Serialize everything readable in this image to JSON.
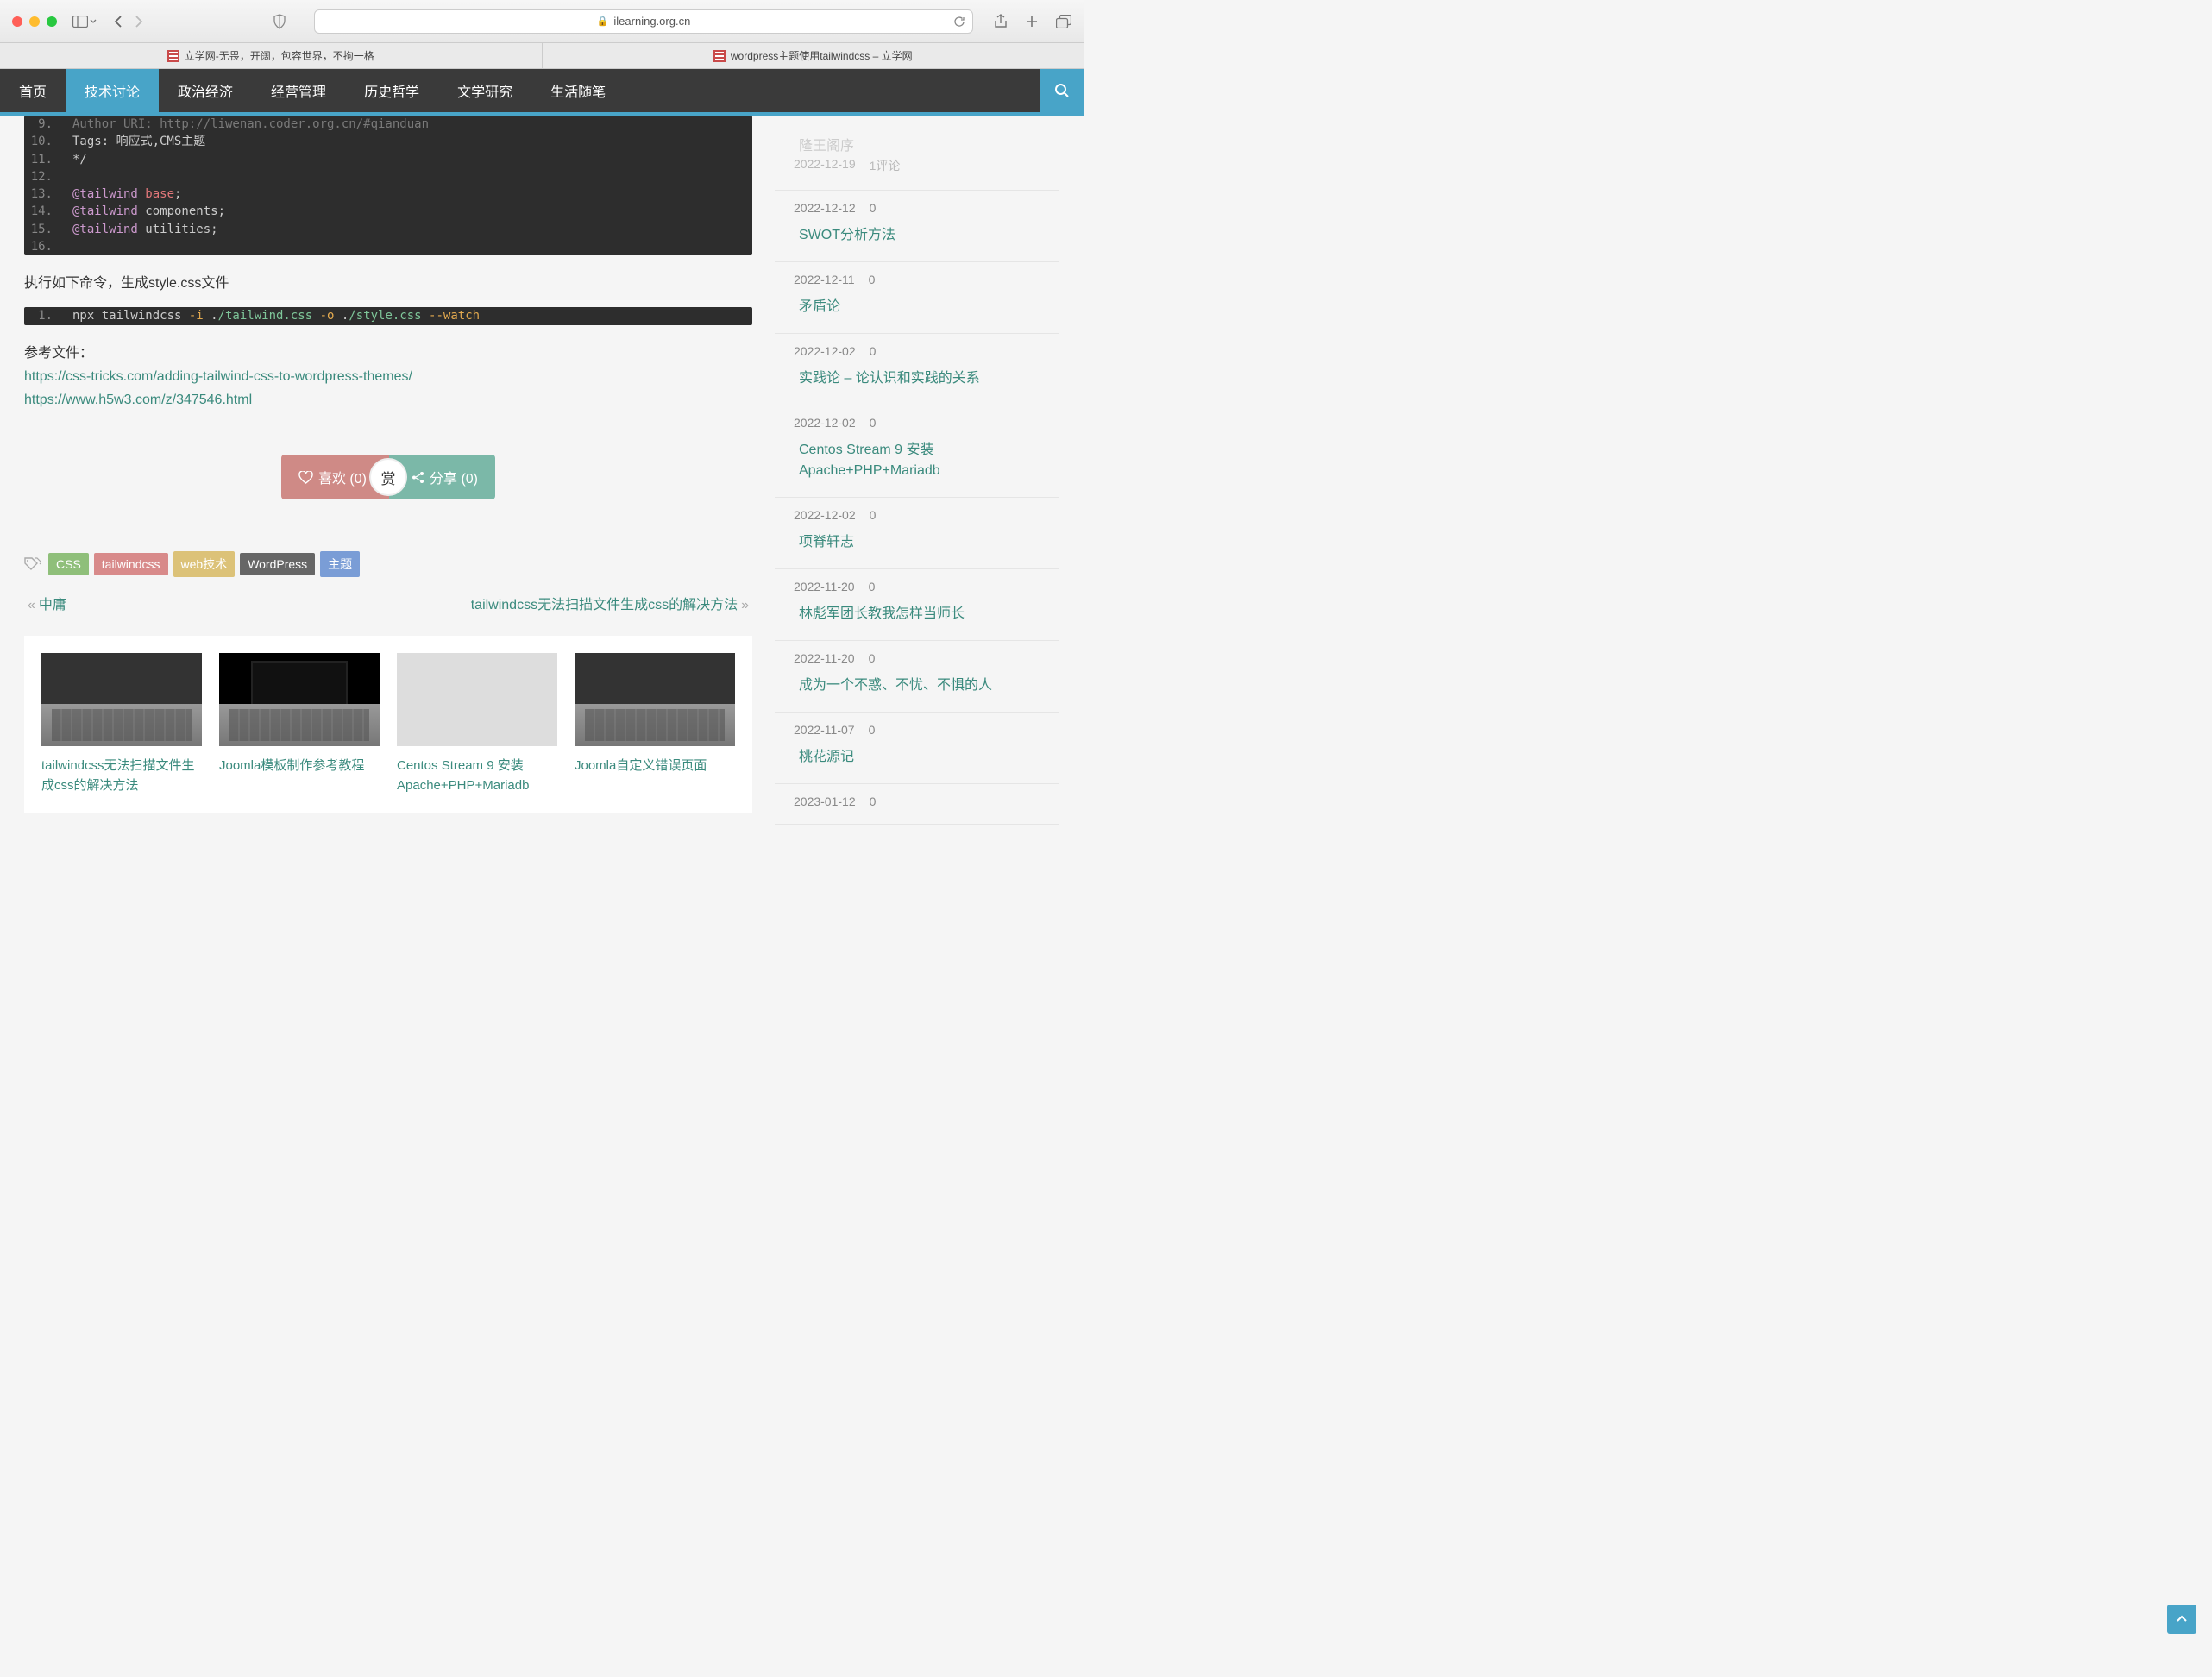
{
  "browser": {
    "url_host": "ilearning.org.cn",
    "tabs": [
      "立学网-无畏，开阔，包容世界，不拘一格",
      "wordpress主题使用tailwindcss – 立学网"
    ]
  },
  "nav": {
    "items": [
      "首页",
      "技术讨论",
      "政治经济",
      "经营管理",
      "历史哲学",
      "文学研究",
      "生活随笔"
    ],
    "active_index": 1
  },
  "code1": {
    "lines": [
      {
        "n": "9.",
        "t": "Author URI: http://liwenan.coder.org.cn/#qianduan",
        "cls": "faint"
      },
      {
        "n": "10.",
        "t": "Tags: 响应式,CMS主题",
        "cls": ""
      },
      {
        "n": "11.",
        "t": "*/",
        "cls": ""
      },
      {
        "n": "12.",
        "t": "",
        "cls": ""
      },
      {
        "n": "13.",
        "html": "<span class='tok-dir'>@tailwind</span> <span class='tok-kw'>base</span>;"
      },
      {
        "n": "14.",
        "html": "<span class='tok-dir'>@tailwind</span> components;"
      },
      {
        "n": "15.",
        "html": "<span class='tok-dir'>@tailwind</span> utilities;"
      },
      {
        "n": "16.",
        "t": "",
        "cls": ""
      }
    ]
  },
  "para1": "执行如下命令，生成style.css文件",
  "code2": {
    "lines": [
      {
        "n": "1.",
        "html": "npx tailwindcss <span class='tok-flag'>-i</span> .<span class='tok-str'>/tailwind.css</span> <span class='tok-flag'>-o</span> .<span class='tok-str'>/style.css</span> <span class='tok-flag'>--watch</span>"
      }
    ]
  },
  "para2": "参考文件：",
  "links": [
    "https://css-tricks.com/adding-tailwind-css-to-wordpress-themes/",
    "https://www.h5w3.com/z/347546.html"
  ],
  "actions": {
    "like_label": "喜欢 (0)",
    "reward_label": "赏",
    "share_label": "分享 (0)"
  },
  "tags": [
    {
      "label": "CSS",
      "color": "#8fbf7a"
    },
    {
      "label": "tailwindcss",
      "color": "#d88a8a"
    },
    {
      "label": "web技术",
      "color": "#dcc278"
    },
    {
      "label": "WordPress",
      "color": "#666666"
    },
    {
      "label": "主题",
      "color": "#7a9dd6"
    }
  ],
  "prevnext": {
    "prev": "中庸",
    "next": "tailwindcss无法扫描文件生成css的解决方法"
  },
  "related": [
    {
      "title": "tailwindcss无法扫描文件生成css的解决方法",
      "thumb": "a"
    },
    {
      "title": "Joomla模板制作参考教程",
      "thumb": "b"
    },
    {
      "title": "Centos Stream 9 安装Apache+PHP+Mariadb",
      "thumb": "c"
    },
    {
      "title": "Joomla自定义错误页面",
      "thumb": "a"
    }
  ],
  "sidebar": [
    {
      "date": "2022-12-19",
      "comments": "1评论",
      "title": "隆王阁序",
      "first": true
    },
    {
      "date": "2022-12-12",
      "comments": "0",
      "title": "SWOT分析方法"
    },
    {
      "date": "2022-12-11",
      "comments": "0",
      "title": "矛盾论"
    },
    {
      "date": "2022-12-02",
      "comments": "0",
      "title": "实践论 – 论认识和实践的关系"
    },
    {
      "date": "2022-12-02",
      "comments": "0",
      "title": "Centos Stream 9 安装Apache+PHP+Mariadb"
    },
    {
      "date": "2022-12-02",
      "comments": "0",
      "title": "项脊轩志"
    },
    {
      "date": "2022-11-20",
      "comments": "0",
      "title": "林彪军团长教我怎样当师长"
    },
    {
      "date": "2022-11-20",
      "comments": "0",
      "title": "成为一个不惑、不忧、不惧的人"
    },
    {
      "date": "2022-11-07",
      "comments": "0",
      "title": "桃花源记"
    },
    {
      "date": "2023-01-12",
      "comments": "0",
      "title": ""
    }
  ]
}
